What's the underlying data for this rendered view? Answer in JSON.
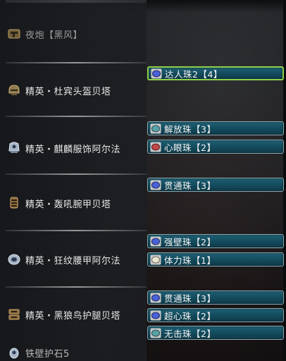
{
  "equipment": [
    {
      "id": "weapon",
      "name": "夜炮【黑风】",
      "icon": "bowgun-icon",
      "style": "dim",
      "jewels": []
    },
    {
      "id": "head",
      "name": "精英・杜宾头盔贝塔",
      "icon": "helmet-icon",
      "style": "normal",
      "jewels": [
        {
          "label": "达人珠2【4】",
          "gem": "gem-blue-icon",
          "gem_color": "#4a62d8",
          "selected": true
        }
      ]
    },
    {
      "id": "chest",
      "name": "精英・麒麟服饰阿尔法",
      "icon": "chest-armor-icon",
      "style": "normal",
      "jewels": [
        {
          "label": "解放珠【3】",
          "gem": "gem-teal-icon",
          "gem_color": "#5aa2a8",
          "selected": false
        },
        {
          "label": "心眼珠【2】",
          "gem": "gem-red-icon",
          "gem_color": "#c24848",
          "selected": false
        }
      ]
    },
    {
      "id": "arms",
      "name": "精英・轰吼腕甲贝塔",
      "icon": "gauntlet-icon",
      "style": "normal",
      "jewels": [
        {
          "label": "贯通珠【3】",
          "gem": "gem-blue-icon",
          "gem_color": "#4a62d8",
          "selected": false
        }
      ]
    },
    {
      "id": "waist",
      "name": "精英・狂纹腰甲阿尔法",
      "icon": "waist-armor-icon",
      "style": "normal",
      "jewels": [
        {
          "label": "强壁珠【2】",
          "gem": "gem-blue-icon",
          "gem_color": "#4a62d8",
          "selected": false
        },
        {
          "label": "体力珠【1】",
          "gem": "gem-white-icon",
          "gem_color": "#d8d8c8",
          "selected": false
        }
      ]
    },
    {
      "id": "legs",
      "name": "精英・黑狼鸟护腿贝塔",
      "icon": "greaves-icon",
      "style": "normal",
      "jewels": [
        {
          "label": "贯通珠【3】",
          "gem": "gem-blue-icon",
          "gem_color": "#4a62d8",
          "selected": false
        },
        {
          "label": "超心珠【2】",
          "gem": "gem-blue-icon",
          "gem_color": "#4a62d8",
          "selected": false
        },
        {
          "label": "无击珠【2】",
          "gem": "gem-teal-icon",
          "gem_color": "#5aa2a8",
          "selected": false
        }
      ]
    },
    {
      "id": "charm",
      "name": "铁壁护石5",
      "icon": "charm-icon",
      "style": "plain",
      "jewels": []
    }
  ],
  "colors": {
    "slot_bg": "#1a5a6e",
    "slot_border": "#8da6ad",
    "selected_border": "#8ed04a"
  }
}
